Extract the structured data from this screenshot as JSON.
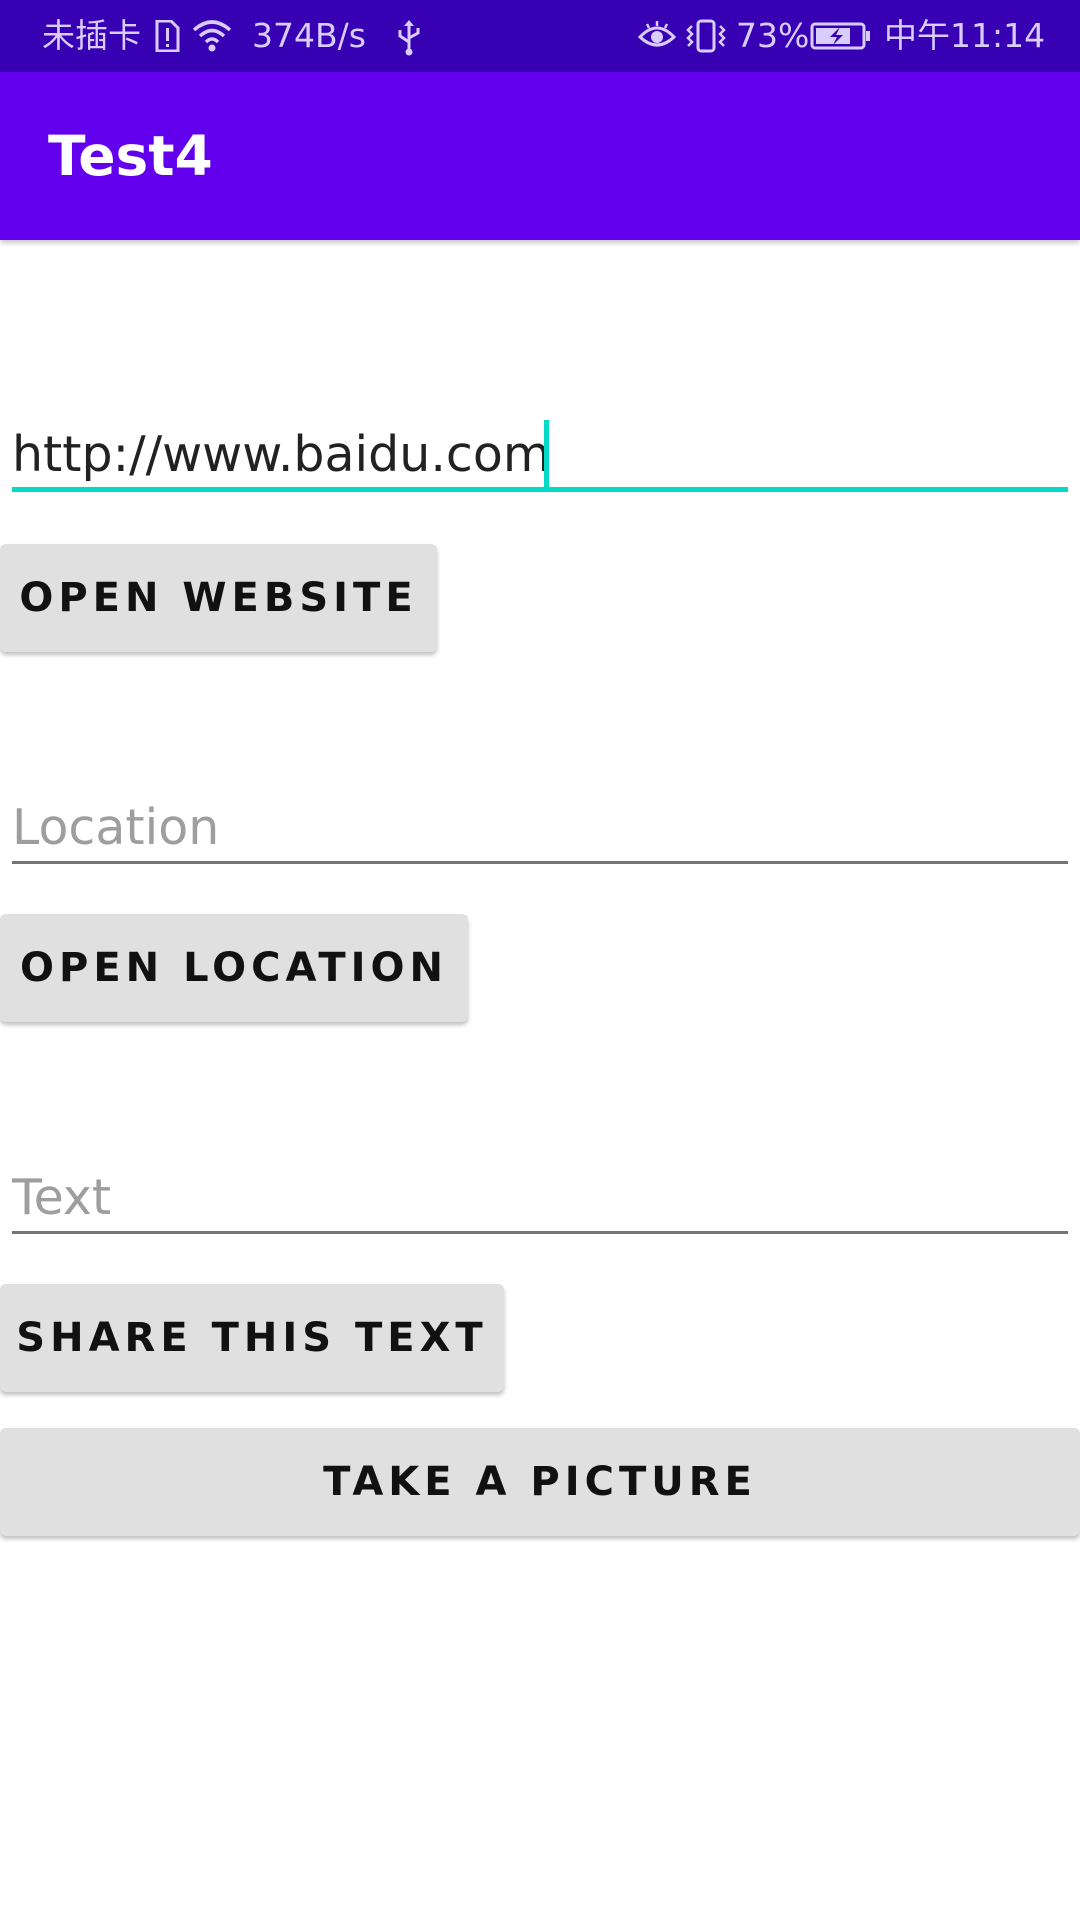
{
  "status_bar": {
    "carrier": "未插卡",
    "network_speed": "374B/s",
    "battery_percent": "73%",
    "time": "中午11:14",
    "icons": [
      "sim-alert-icon",
      "wifi-icon",
      "usb-icon",
      "eye-icon",
      "vibrate-icon",
      "battery-charging-icon"
    ]
  },
  "app_bar": {
    "title": "Test4"
  },
  "website": {
    "value": "http://www.baidu.com",
    "button_label": "OPEN WEBSITE"
  },
  "location": {
    "value": "",
    "placeholder": "Location",
    "button_label": "OPEN LOCATION"
  },
  "share": {
    "value": "",
    "placeholder": "Text",
    "button_label": "SHARE THIS TEXT"
  },
  "camera": {
    "button_label": "TAKE A PICTURE"
  },
  "colors": {
    "status_bar": "#3700B3",
    "app_bar": "#6200EE",
    "accent": "#03DAC5",
    "button_bg": "#E0E0E0"
  }
}
